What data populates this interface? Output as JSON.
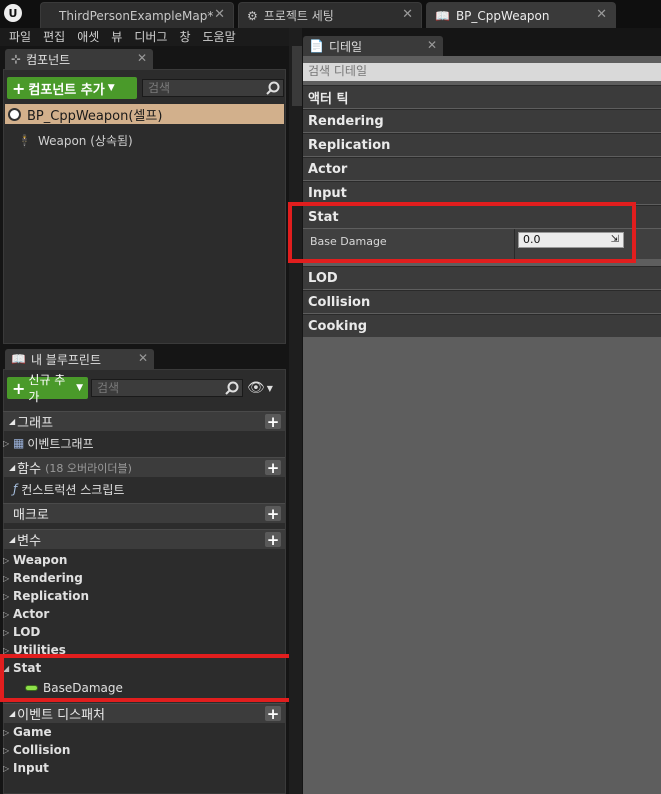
{
  "tabs": [
    {
      "label": "ThirdPersonExampleMap*"
    },
    {
      "label": "프로젝트 세팅"
    },
    {
      "label": "BP_CppWeapon"
    }
  ],
  "menu": [
    "파일",
    "편집",
    "애셋",
    "뷰",
    "디버그",
    "창",
    "도움말"
  ],
  "components": {
    "tab_label": "컴포넌트",
    "add_button": "컴포넌트 추가",
    "search_placeholder": "검색",
    "root_item": "BP_CppWeapon(셀프)",
    "child_item": "Weapon (상속됨)"
  },
  "my_blueprint": {
    "tab_label": "내 블루프린트",
    "add_button": "신규 추가",
    "search_placeholder": "검색",
    "graph_header": "그래프",
    "event_graph": "이벤트그래프",
    "functions_header": "함수",
    "functions_sub": "(18 오버라이더블)",
    "construction_script": "컨스트럭션 스크립트",
    "macros_header": "매크로",
    "variables_header": "변수",
    "variable_groups": [
      "Weapon",
      "Rendering",
      "Replication",
      "Actor",
      "LOD",
      "Utilities"
    ],
    "stat_group": "Stat",
    "stat_variable": "BaseDamage",
    "dispatchers_header": "이벤트 디스패처",
    "dispatcher_groups": [
      "Game",
      "Collision",
      "Input"
    ]
  },
  "details": {
    "tab_label": "디테일",
    "search_placeholder": "검색 디테일",
    "categories_top": [
      "액터 틱",
      "Rendering",
      "Replication",
      "Actor",
      "Input"
    ],
    "stat_category": "Stat",
    "property_label": "Base Damage",
    "property_value": "0.0",
    "categories_bottom": [
      "LOD",
      "Collision",
      "Cooking"
    ]
  },
  "colors": {
    "highlight": "#e11e1e",
    "add_button": "#4a9a2a",
    "selected_row": "#d2b08c"
  }
}
